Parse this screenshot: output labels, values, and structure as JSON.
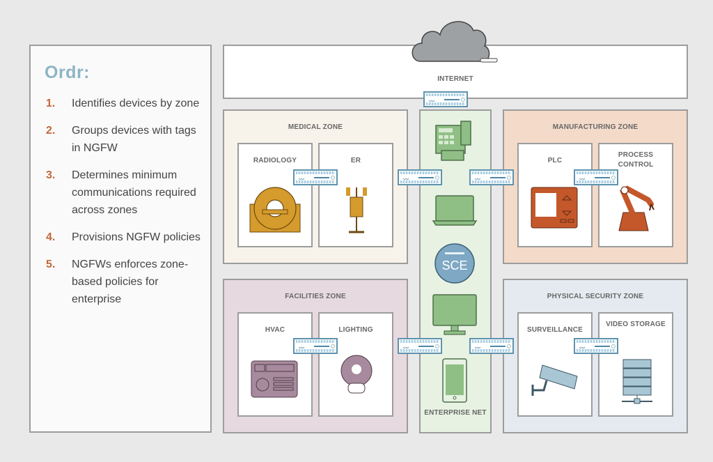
{
  "panel": {
    "title": "Ordr:",
    "steps": [
      {
        "num": "1.",
        "text": "Identifies devices by zone"
      },
      {
        "num": "2.",
        "text": "Groups devices with tags in NGFW"
      },
      {
        "num": "3.",
        "text": "Determines minimum communications required across zones"
      },
      {
        "num": "4.",
        "text": "Provisions NGFW policies"
      },
      {
        "num": "5.",
        "text": "NGFWs enforces zone-based policies for enterprise"
      }
    ]
  },
  "internet": {
    "label": "INTERNET",
    "icon": "cloud-icon"
  },
  "zones": {
    "medical": {
      "title": "MEDICAL ZONE",
      "devices": [
        {
          "label": "RADIOLOGY",
          "icon": "mri-scanner-icon"
        },
        {
          "label": "ER",
          "icon": "iv-pump-icon"
        }
      ]
    },
    "manufacturing": {
      "title": "MANUFACTURING ZONE",
      "devices": [
        {
          "label": "PLC",
          "icon": "plc-controller-icon"
        },
        {
          "label": "PROCESS CONTROL",
          "icon": "robot-arm-icon"
        }
      ]
    },
    "facilities": {
      "title": "FACILITIES ZONE",
      "devices": [
        {
          "label": "HVAC",
          "icon": "hvac-panel-icon"
        },
        {
          "label": "LIGHTING",
          "icon": "light-bulb-icon"
        }
      ]
    },
    "physical": {
      "title": "PHYSICAL SECURITY ZONE",
      "devices": [
        {
          "label": "SURVEILLANCE",
          "icon": "security-camera-icon"
        },
        {
          "label": "VIDEO STORAGE",
          "icon": "server-rack-icon"
        }
      ]
    },
    "enterprise": {
      "title": "ENTERPRISE NET",
      "devices": [
        "fax-phone-icon",
        "laptop-icon",
        "sce-badge-icon",
        "desktop-monitor-icon",
        "smartphone-icon"
      ],
      "sce_label": "SCE"
    }
  },
  "firewall": {
    "wave_glyph": "〰",
    "icon": "firewall-icon"
  },
  "colors": {
    "accent_title": "#8db5c6",
    "step_number": "#c3673b",
    "medical": "#d59b2c",
    "manufacturing": "#c4582a",
    "facilities": "#a78a9d",
    "physical": "#a9c6d4",
    "enterprise": "#8fbf85",
    "firewall": "#5e93ad"
  }
}
